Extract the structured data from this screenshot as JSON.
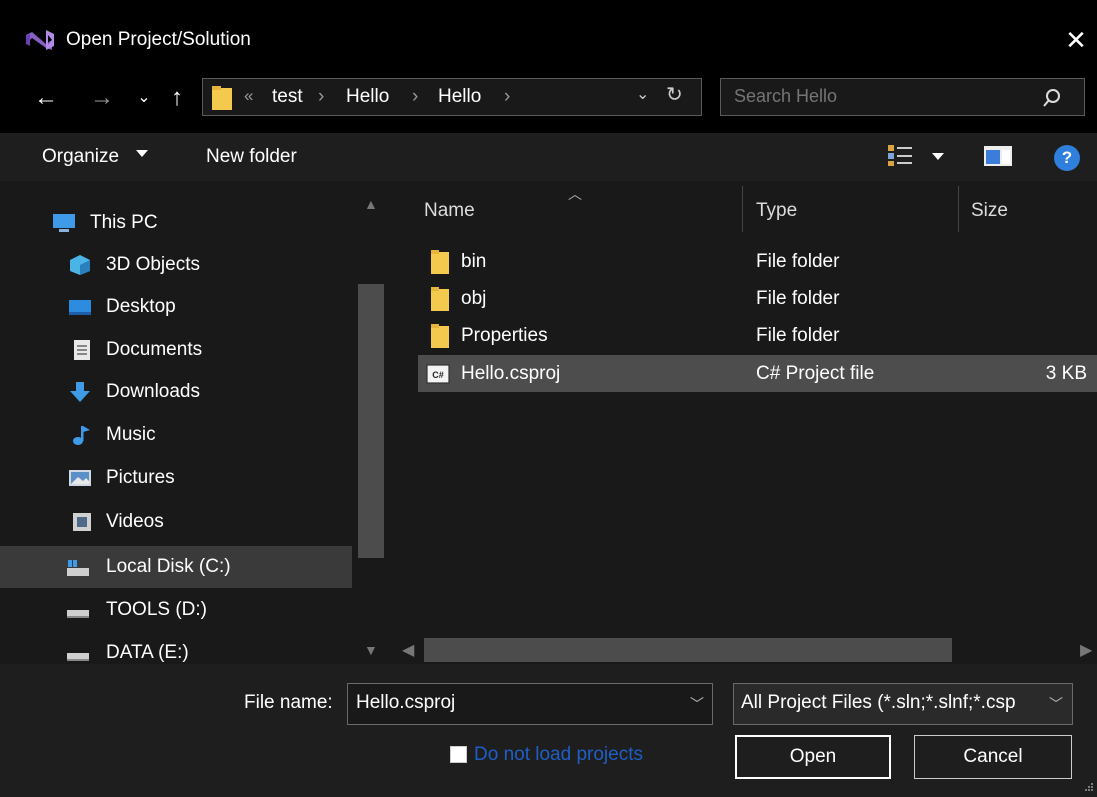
{
  "window": {
    "title": "Open Project/Solution",
    "close_glyph": "✕"
  },
  "nav": {
    "back_glyph": "←",
    "forward_glyph": "→",
    "recent_glyph": "⌄",
    "up_glyph": "↑"
  },
  "address": {
    "overflow_glyph": "«",
    "crumbs": [
      "test",
      "Hello",
      "Hello"
    ],
    "separator": "›",
    "dropdown_glyph": "⌄",
    "refresh_glyph": "↻"
  },
  "search": {
    "placeholder": "Search Hello"
  },
  "toolbar": {
    "organize_label": "Organize",
    "new_folder_label": "New folder",
    "help_label": "?"
  },
  "nav_pane": {
    "items": [
      {
        "label": "This PC",
        "icon": "this-pc-icon"
      },
      {
        "label": "3D Objects",
        "icon": "3d-objects-icon"
      },
      {
        "label": "Desktop",
        "icon": "desktop-icon"
      },
      {
        "label": "Documents",
        "icon": "documents-icon"
      },
      {
        "label": "Downloads",
        "icon": "downloads-icon"
      },
      {
        "label": "Music",
        "icon": "music-icon"
      },
      {
        "label": "Pictures",
        "icon": "pictures-icon"
      },
      {
        "label": "Videos",
        "icon": "videos-icon"
      },
      {
        "label": "Local Disk (C:)",
        "icon": "local-disk-icon"
      },
      {
        "label": "TOOLS (D:)",
        "icon": "drive-icon"
      },
      {
        "label": "DATA (E:)",
        "icon": "drive-icon"
      }
    ],
    "selected_label": "Local Disk (C:)"
  },
  "columns": {
    "name": "Name",
    "type": "Type",
    "size": "Size"
  },
  "files": [
    {
      "name": "bin",
      "type": "File folder",
      "size": "",
      "icon": "folder-icon"
    },
    {
      "name": "obj",
      "type": "File folder",
      "size": "",
      "icon": "folder-icon"
    },
    {
      "name": "Properties",
      "type": "File folder",
      "size": "",
      "icon": "folder-icon"
    },
    {
      "name": "Hello.csproj",
      "type": "C# Project file",
      "size": "3 KB",
      "icon": "csproj-icon"
    }
  ],
  "selected_file": "Hello.csproj",
  "footer": {
    "file_name_label": "File name:",
    "file_name_value": "Hello.csproj",
    "filter_value": "All Project Files (*.sln;*.slnf;*.csp",
    "do_not_load_label": "Do not load projects",
    "open_label": "Open",
    "cancel_label": "Cancel"
  },
  "colors": {
    "background": "#000000",
    "pane": "#191919",
    "selection": "#4d4d4d",
    "accent_link": "#1e5fc6",
    "vs_purple": "#865fc5",
    "folder_yellow": "#f3c94e"
  }
}
